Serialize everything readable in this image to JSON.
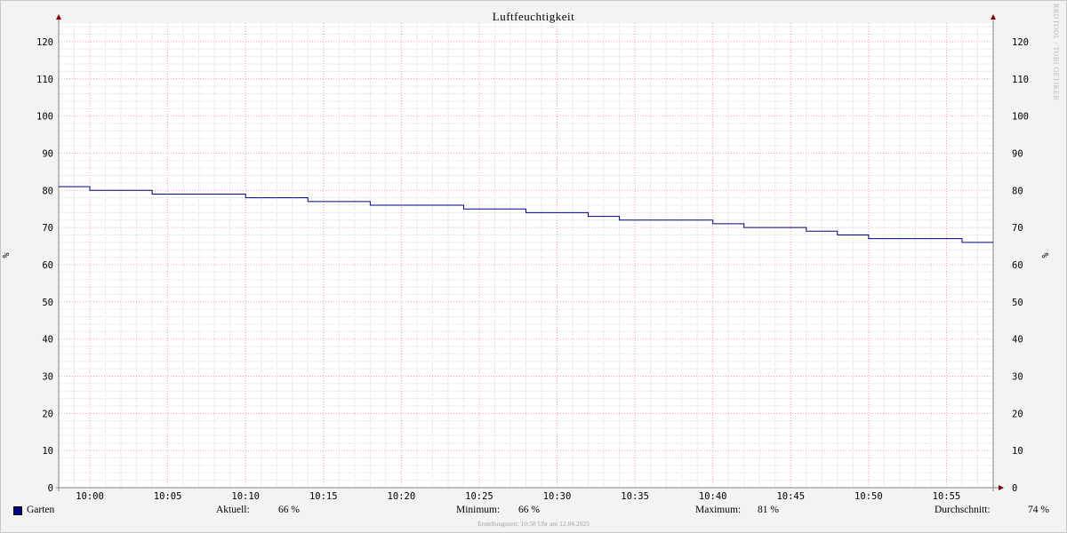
{
  "title": "Luftfeuchtigkeit",
  "watermark": "RRDTOOL / TOBI OETIKER",
  "footer": "Erstellungszeit: 10:58 Uhr am 12.04.2025",
  "colors": {
    "background": "#f3f3f3",
    "plot_background": "#ffffff",
    "series": "#000080",
    "major_grid": "#f0a0a0",
    "minor_grid": "#dcdcdc",
    "axis": "#808080",
    "arrow": "#800000"
  },
  "legend": {
    "series_name": "Garten",
    "current_label": "Aktuell:",
    "current_value": "66 %",
    "min_label": "Minimum:",
    "min_value": "66 %",
    "max_label": "Maximum:",
    "max_value": "81 %",
    "avg_label": "Durchschnitt:",
    "avg_value": "74 %"
  },
  "chart_data": {
    "type": "line",
    "title": "Luftfeuchtigkeit",
    "ylabel": "%",
    "ylim": [
      0,
      125
    ],
    "yticks": [
      0,
      10,
      20,
      30,
      40,
      50,
      60,
      70,
      80,
      90,
      100,
      110,
      120
    ],
    "xlim": [
      "09:58",
      "10:58"
    ],
    "xticks": [
      "10:00",
      "10:05",
      "10:10",
      "10:15",
      "10:20",
      "10:25",
      "10:30",
      "10:35",
      "10:40",
      "10:45",
      "10:50",
      "10:55"
    ],
    "grid": true,
    "step": true,
    "series": [
      {
        "name": "Garten",
        "points": [
          [
            "09:58",
            81
          ],
          [
            "10:00",
            80
          ],
          [
            "10:02",
            80
          ],
          [
            "10:04",
            79
          ],
          [
            "10:10",
            78
          ],
          [
            "10:14",
            77
          ],
          [
            "10:18",
            76
          ],
          [
            "10:24",
            75
          ],
          [
            "10:28",
            74
          ],
          [
            "10:32",
            73
          ],
          [
            "10:34",
            72
          ],
          [
            "10:40",
            71
          ],
          [
            "10:42",
            70
          ],
          [
            "10:46",
            69
          ],
          [
            "10:48",
            68
          ],
          [
            "10:50",
            67
          ],
          [
            "10:56",
            66
          ],
          [
            "10:58",
            66
          ]
        ]
      }
    ]
  }
}
